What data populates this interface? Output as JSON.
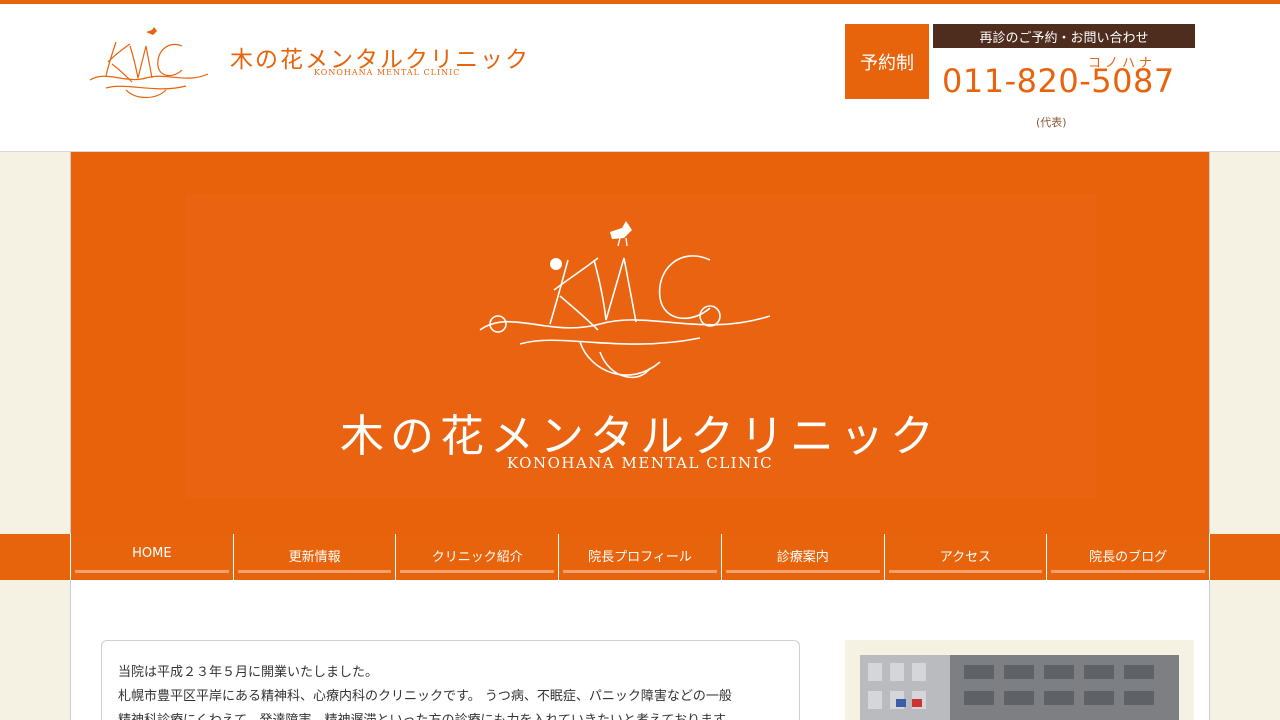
{
  "header": {
    "logo_name": "木の花メンタルクリニック",
    "logo_sub": "KONOHANA MENTAL CLINIC",
    "reservation_badge": "予約制",
    "contact_label": "再診のご予約・お問い合わせ",
    "phone_kana": "コノハナ",
    "phone": "011-820-5087",
    "phone_note": "(代表)"
  },
  "hero": {
    "title": "木の花メンタルクリニック",
    "subtitle": "KONOHANA MENTAL CLINIC",
    "monogram": "KMC"
  },
  "nav": {
    "items": [
      {
        "label": "HOME"
      },
      {
        "label": "更新情報"
      },
      {
        "label": "クリニック紹介"
      },
      {
        "label": "院長プロフィール"
      },
      {
        "label": "診療案内"
      },
      {
        "label": "アクセス"
      },
      {
        "label": "院長のブログ"
      }
    ]
  },
  "intro": {
    "line1": "当院は平成２３年５月に開業いたしました。",
    "line2": "札幌市豊平区平岸にある精神科、心療内科のクリニックです。 うつ病、不眠症、パニック障害などの一般",
    "line3": "精神科診療にくわえて、発達障害、精神遅滞といった方の診療にも力を入れていきたいと考えております。"
  },
  "colors": {
    "accent": "#e8640c",
    "dark_brown": "#4e2c1e",
    "background": "#f5f2e3"
  }
}
